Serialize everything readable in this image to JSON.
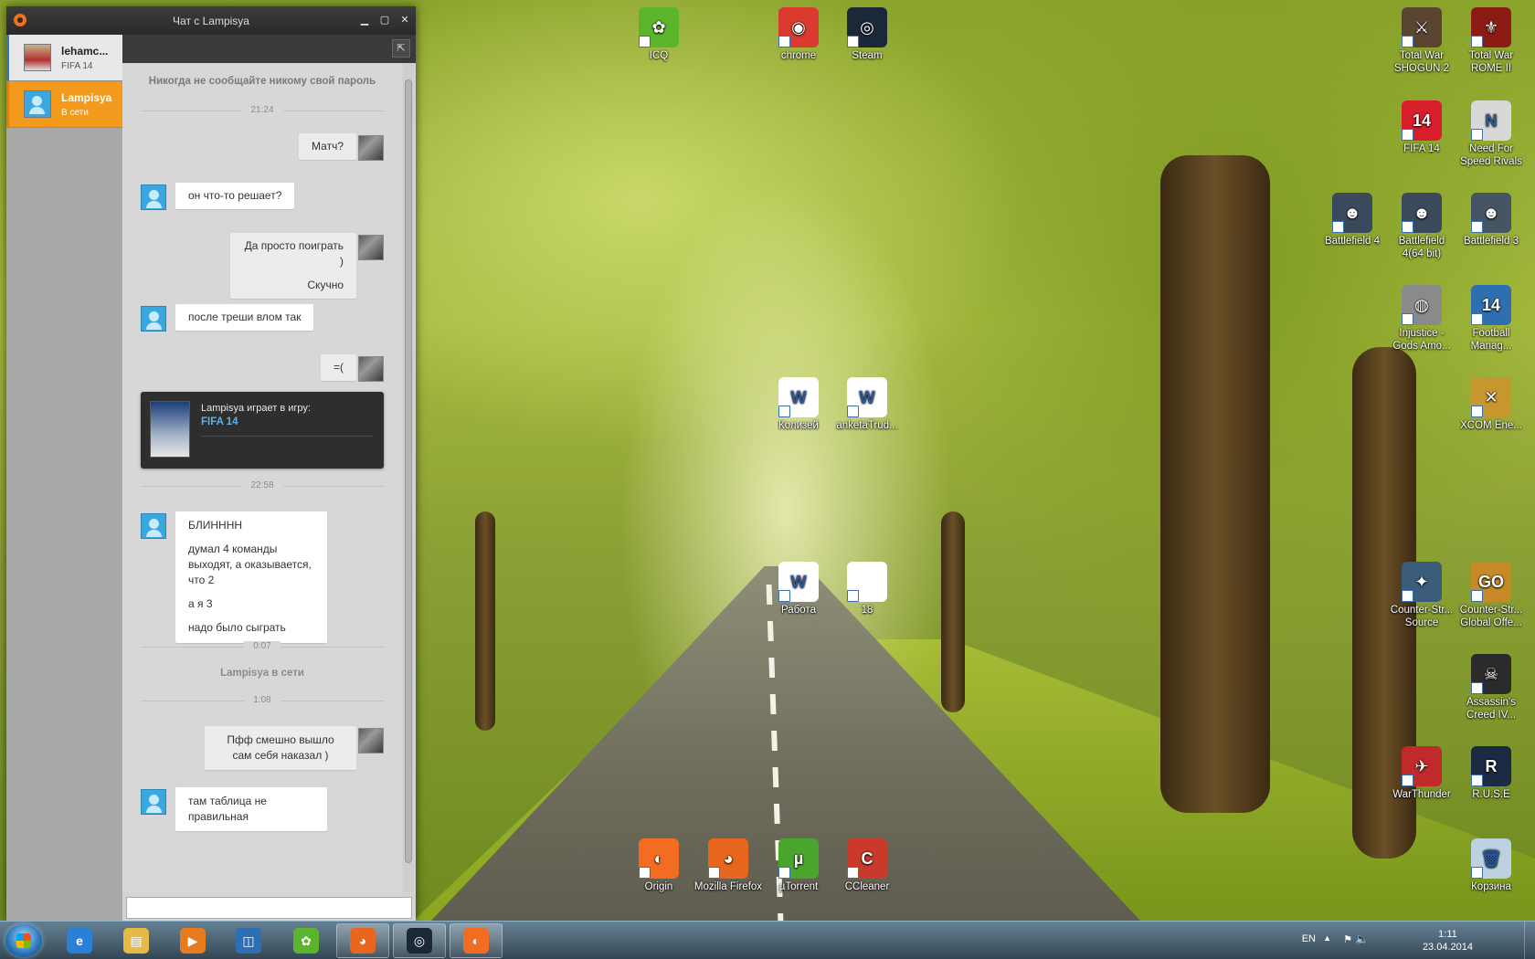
{
  "window": {
    "title": "Чат с Lampisya",
    "min_icon": "minimize-icon",
    "max_icon": "maximize-icon",
    "close_icon": "close-icon"
  },
  "contacts": [
    {
      "name": "lehamc...",
      "status": "FIFA 14"
    },
    {
      "name": "Lampisya",
      "status": "В сети"
    }
  ],
  "chat": {
    "notice": "Никогда не сообщайте никому свой пароль",
    "time_1": "21:24",
    "messages_a": [
      {
        "from": "me",
        "lines": [
          "Матч?"
        ]
      },
      {
        "from": "them",
        "lines": [
          "он что-то решает?"
        ]
      },
      {
        "from": "me",
        "lines": [
          "Да просто поиграть )",
          "Скучно"
        ]
      },
      {
        "from": "them",
        "lines": [
          "после треши влом так"
        ]
      },
      {
        "from": "me",
        "lines": [
          "=("
        ]
      }
    ],
    "game_card": {
      "line": "Lampisya играет в игру:",
      "game": "FIFA 14"
    },
    "time_2": "22:58",
    "message_b": {
      "from": "them",
      "lines": [
        "БЛИНННН",
        "думал 4 команды выходят, а оказывается, что 2",
        "а я 3",
        "надо было сыграть"
      ]
    },
    "time_3": "0:07",
    "status_line": "Lampisya в сети",
    "time_4": "1:08",
    "messages_c": [
      {
        "from": "me",
        "lines": [
          "Пфф смешно вышло сам себя наказал )"
        ]
      },
      {
        "from": "them",
        "lines": [
          "там таблица не правильная"
        ]
      }
    ],
    "input_value": ""
  },
  "desktop_icons": [
    {
      "label": "ICQ",
      "color": "#5bb52c",
      "glyph": "✿"
    },
    {
      "label": "chrome",
      "color": "#db3a2f",
      "glyph": "◉"
    },
    {
      "label": "Steam",
      "color": "#1b2838",
      "glyph": "◎"
    },
    {
      "label": "Total War SHOGUN 2",
      "color": "#5a4630",
      "glyph": "⚔"
    },
    {
      "label": "Total War ROME II",
      "color": "#8a1c14",
      "glyph": "⚜"
    },
    {
      "label": "FIFA 14",
      "color": "#d81e2a",
      "glyph": "14"
    },
    {
      "label": "Need For Speed Rivals",
      "color": "#d8d8d8",
      "glyph": "N"
    },
    {
      "label": "Battlefield 4",
      "color": "#3a4a5c",
      "glyph": "☻"
    },
    {
      "label": "Battlefield 4(64 bit)",
      "color": "#3a4a5c",
      "glyph": "☻"
    },
    {
      "label": "Battlefield 3",
      "color": "#465564",
      "glyph": "☻"
    },
    {
      "label": "Injustice - Gods Amo...",
      "color": "#8a8a8a",
      "glyph": "◍"
    },
    {
      "label": "Football Manag...",
      "color": "#2f6fb0",
      "glyph": "14"
    },
    {
      "label": "XCOM Ene...",
      "color": "#c7962c",
      "glyph": "✕"
    },
    {
      "label": "Колизей",
      "color": "#ffffff",
      "glyph": "W"
    },
    {
      "label": "anketaTrud...",
      "color": "#ffffff",
      "glyph": "W"
    },
    {
      "label": "Работа",
      "color": "#ffffff",
      "glyph": "W"
    },
    {
      "label": "18",
      "color": "#ffffff",
      "glyph": ""
    },
    {
      "label": "Counter-Str... Source",
      "color": "#3a5b7a",
      "glyph": "✦"
    },
    {
      "label": "Counter-Str... Global Offe...",
      "color": "#c88a28",
      "glyph": "GO"
    },
    {
      "label": "Assassin's Creed IV...",
      "color": "#2b2b2b",
      "glyph": "☠"
    },
    {
      "label": "WarThunder",
      "color": "#c02a2a",
      "glyph": "✈"
    },
    {
      "label": "R.U.S.E",
      "color": "#1d2a44",
      "glyph": "R"
    },
    {
      "label": "Origin",
      "color": "#f26c22",
      "glyph": "◐"
    },
    {
      "label": "Mozilla Firefox",
      "color": "#e8661d",
      "glyph": "◕"
    },
    {
      "label": "µTorrent",
      "color": "#4aa52e",
      "glyph": "µ"
    },
    {
      "label": "CCleaner",
      "color": "#c93a2b",
      "glyph": "C"
    },
    {
      "label": "Корзина",
      "color": "#bcd2e0",
      "glyph": "🗑"
    }
  ],
  "taskbar": {
    "apps": [
      {
        "name": "internet-explorer",
        "color": "#2a80d6",
        "glyph": "e"
      },
      {
        "name": "explorer",
        "color": "#e7b946",
        "glyph": "▤"
      },
      {
        "name": "media-player",
        "color": "#e87b1d",
        "glyph": "▶"
      },
      {
        "name": "photo-viewer",
        "color": "#2c6fb2",
        "glyph": "◫"
      },
      {
        "name": "icq",
        "color": "#5bb52c",
        "glyph": "✿"
      },
      {
        "name": "firefox",
        "color": "#e8661d",
        "glyph": "◕"
      },
      {
        "name": "steam",
        "color": "#1b2838",
        "glyph": "◎"
      },
      {
        "name": "origin",
        "color": "#f26c22",
        "glyph": "◐"
      }
    ],
    "lang": "EN",
    "time": "1:11",
    "date": "23.04.2014"
  }
}
